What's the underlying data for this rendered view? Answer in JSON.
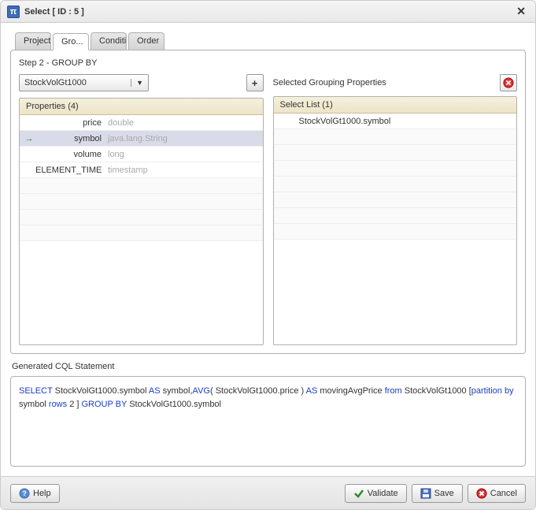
{
  "window": {
    "title": "Select [ ID : 5 ]"
  },
  "tabs": [
    {
      "label": "Project"
    },
    {
      "label": "Gro...",
      "active": true
    },
    {
      "label": "Condition"
    },
    {
      "label": "Order"
    }
  ],
  "step_label": "Step 2 - GROUP BY",
  "stream_dropdown": {
    "value": "StockVolGt1000"
  },
  "properties": {
    "header": "Properties (4)",
    "rows": [
      {
        "name": "price",
        "type": "double",
        "indicator": ""
      },
      {
        "name": "symbol",
        "type": "java.lang.String",
        "indicator": "→",
        "selected": true
      },
      {
        "name": "volume",
        "type": "long",
        "indicator": ""
      },
      {
        "name": "ELEMENT_TIME",
        "type": "timestamp",
        "indicator": ""
      }
    ],
    "empty_rows": 4
  },
  "selected_panel": {
    "title": "Selected Grouping Properties",
    "list_header": "Select List (1)",
    "items": [
      "StockVolGt1000.symbol"
    ],
    "empty_rows": 7
  },
  "cql_section_label": "Generated CQL Statement",
  "cql": {
    "tokens": [
      {
        "t": "SELECT",
        "kw": true
      },
      {
        "t": " StockVolGt1000.symbol "
      },
      {
        "t": "AS",
        "kw": true
      },
      {
        "t": " symbol,"
      },
      {
        "t": "AVG",
        "kw": true
      },
      {
        "t": "( StockVolGt1000.price ) "
      },
      {
        "t": "AS",
        "kw": true
      },
      {
        "t": " movingAvgPrice "
      },
      {
        "t": "from ",
        "kw": true
      },
      {
        "t": " StockVolGt1000 ["
      },
      {
        "t": "partition by",
        "kw": true
      },
      {
        "t": "  symbol  "
      },
      {
        "t": "rows",
        "kw": true
      },
      {
        "t": " 2 ] "
      },
      {
        "t": "GROUP BY",
        "kw": true
      },
      {
        "t": " StockVolGt1000.symbol"
      }
    ]
  },
  "buttons": {
    "help": "Help",
    "validate": "Validate",
    "save": "Save",
    "cancel": "Cancel"
  }
}
